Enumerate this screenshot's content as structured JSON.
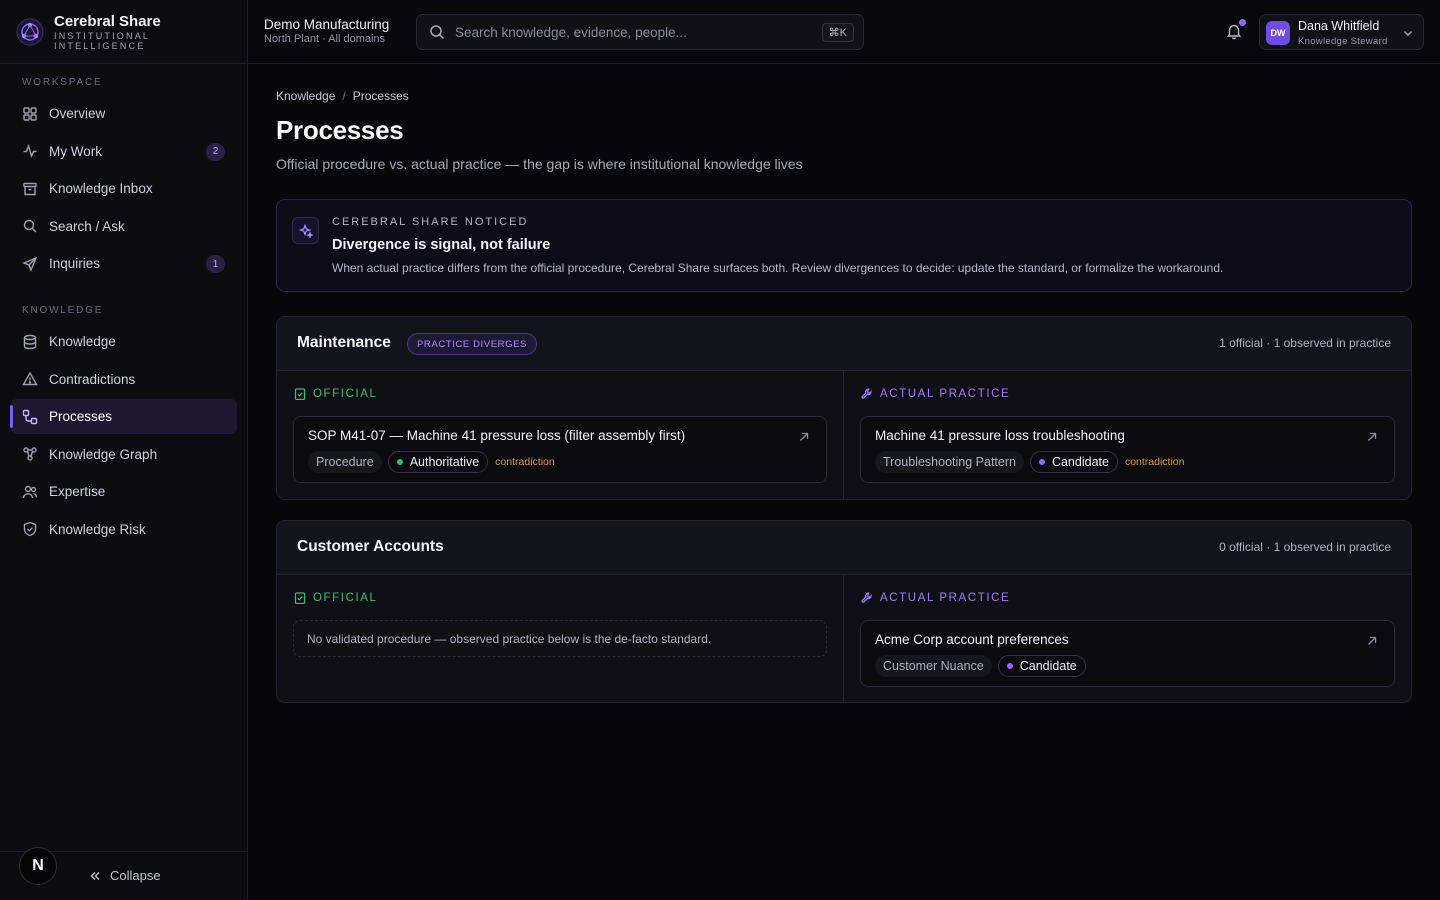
{
  "brand": {
    "name": "Cerebral Share",
    "tagline": "INSTITUTIONAL INTELLIGENCE"
  },
  "sidebar": {
    "workspace_label": "WORKSPACE",
    "workspace_items": [
      {
        "label": "Overview",
        "icon": "grid-icon"
      },
      {
        "label": "My Work",
        "icon": "activity-icon",
        "badge": "2"
      },
      {
        "label": "Knowledge Inbox",
        "icon": "inbox-icon"
      },
      {
        "label": "Search / Ask",
        "icon": "search-icon"
      },
      {
        "label": "Inquiries",
        "icon": "send-icon",
        "badge": "1"
      }
    ],
    "knowledge_label": "KNOWLEDGE",
    "knowledge_items": [
      {
        "label": "Knowledge",
        "icon": "database-icon"
      },
      {
        "label": "Contradictions",
        "icon": "warning-icon"
      },
      {
        "label": "Processes",
        "icon": "workflow-icon",
        "active": true
      },
      {
        "label": "Knowledge Graph",
        "icon": "graph-icon"
      },
      {
        "label": "Expertise",
        "icon": "people-icon"
      },
      {
        "label": "Knowledge Risk",
        "icon": "shield-icon"
      }
    ],
    "footer": {
      "avatar_letter": "N",
      "collapse_label": "Collapse"
    }
  },
  "topbar": {
    "org_name": "Demo Manufacturing",
    "org_scope": "North Plant · All domains",
    "search_placeholder": "Search knowledge, evidence, people...",
    "search_shortcut": "⌘K",
    "user": {
      "initials": "DW",
      "name": "Dana Whitfield",
      "role": "Knowledge Steward"
    }
  },
  "page": {
    "breadcrumb": [
      "Knowledge",
      "Processes"
    ],
    "title": "Processes",
    "subtitle": "Official procedure vs. actual practice — the gap is where institutional knowledge lives"
  },
  "notice": {
    "eyebrow": "CEREBRAL SHARE NOTICED",
    "title": "Divergence is signal, not failure",
    "body": "When actual practice differs from the official procedure, Cerebral Share surfaces both. Review divergences to decide: update the standard, or formalize the workaround."
  },
  "groups": [
    {
      "title": "Maintenance",
      "badge": "PRACTICE DIVERGES",
      "stats": "1 official · 1 observed in practice",
      "official_label": "OFFICIAL",
      "practice_label": "ACTUAL PRACTICE",
      "official": {
        "title": "SOP M41-07 — Machine 41 pressure loss (filter assembly first)",
        "type": "Procedure",
        "status": "Authoritative",
        "flag": "contradiction"
      },
      "practice": {
        "title": "Machine 41 pressure loss troubleshooting",
        "type": "Troubleshooting Pattern",
        "status": "Candidate",
        "flag": "contradiction"
      }
    },
    {
      "title": "Customer Accounts",
      "stats": "0 official · 1 observed in practice",
      "official_label": "OFFICIAL",
      "practice_label": "ACTUAL PRACTICE",
      "official_empty": "No validated procedure — observed practice below is the de-facto standard.",
      "practice": {
        "title": "Acme Corp account preferences",
        "type": "Customer Nuance",
        "status": "Candidate"
      }
    }
  ],
  "colors": {
    "accent": "#7c5cf0",
    "official_green": "#36c37a",
    "practice_purple": "#a17cff",
    "contradiction_orange": "#e39c37",
    "background": "#08080c"
  }
}
